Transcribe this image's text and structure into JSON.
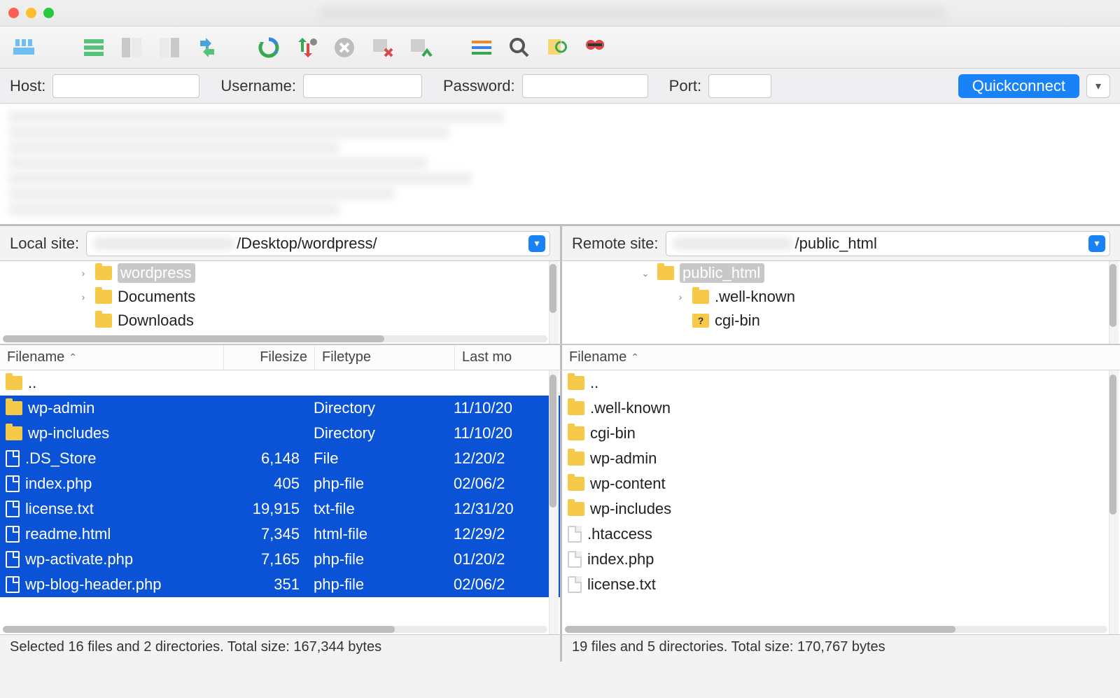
{
  "qc": {
    "host_label": "Host:",
    "user_label": "Username:",
    "pass_label": "Password:",
    "port_label": "Port:",
    "button": "Quickconnect"
  },
  "local": {
    "label": "Local site:",
    "path": "/Desktop/wordpress/",
    "tree": [
      {
        "name": "wordpress",
        "selected": true,
        "expandable": true
      },
      {
        "name": "Documents",
        "expandable": true
      },
      {
        "name": "Downloads"
      }
    ],
    "columns": {
      "name": "Filename",
      "size": "Filesize",
      "type": "Filetype",
      "date": "Last mo"
    },
    "rows": [
      {
        "kind": "up",
        "name": "..",
        "sel": false
      },
      {
        "kind": "dir",
        "name": "wp-admin",
        "type": "Directory",
        "date": "11/10/20",
        "sel": true
      },
      {
        "kind": "dir",
        "name": "wp-includes",
        "type": "Directory",
        "date": "11/10/20",
        "sel": true
      },
      {
        "kind": "file",
        "name": ".DS_Store",
        "size": "6,148",
        "type": "File",
        "date": "12/20/2",
        "sel": true
      },
      {
        "kind": "file",
        "name": "index.php",
        "size": "405",
        "type": "php-file",
        "date": "02/06/2",
        "sel": true
      },
      {
        "kind": "file",
        "name": "license.txt",
        "size": "19,915",
        "type": "txt-file",
        "date": "12/31/20",
        "sel": true
      },
      {
        "kind": "file",
        "name": "readme.html",
        "size": "7,345",
        "type": "html-file",
        "date": "12/29/2",
        "sel": true
      },
      {
        "kind": "file",
        "name": "wp-activate.php",
        "size": "7,165",
        "type": "php-file",
        "date": "01/20/2",
        "sel": true
      },
      {
        "kind": "file",
        "name": "wp-blog-header.php",
        "size": "351",
        "type": "php-file",
        "date": "02/06/2",
        "sel": true
      }
    ],
    "status": "Selected 16 files and 2 directories. Total size: 167,344 bytes"
  },
  "remote": {
    "label": "Remote site:",
    "path": "/public_html",
    "tree": [
      {
        "name": "public_html",
        "selected": true,
        "expanded": true
      },
      {
        "name": ".well-known",
        "expandable": true,
        "sub": true
      },
      {
        "name": "cgi-bin",
        "q": true,
        "sub": true
      }
    ],
    "columns": {
      "name": "Filename"
    },
    "rows": [
      {
        "kind": "up",
        "name": ".."
      },
      {
        "kind": "dir",
        "name": ".well-known"
      },
      {
        "kind": "dir",
        "name": "cgi-bin"
      },
      {
        "kind": "dir",
        "name": "wp-admin"
      },
      {
        "kind": "dir",
        "name": "wp-content"
      },
      {
        "kind": "dir",
        "name": "wp-includes"
      },
      {
        "kind": "file",
        "name": ".htaccess"
      },
      {
        "kind": "file",
        "name": "index.php"
      },
      {
        "kind": "file",
        "name": "license.txt"
      }
    ],
    "status": "19 files and 5 directories. Total size: 170,767 bytes"
  }
}
